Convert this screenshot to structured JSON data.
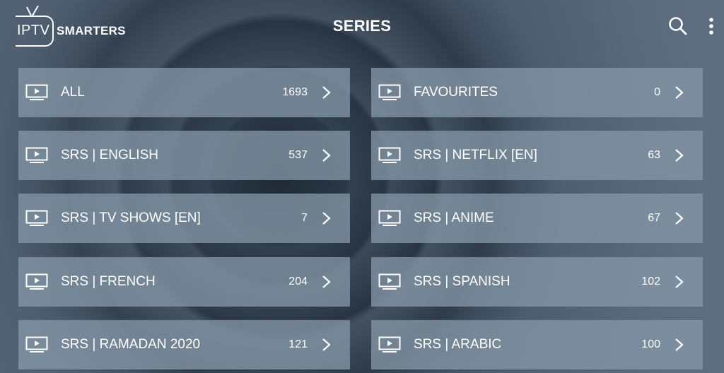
{
  "header": {
    "logo_iptv": "IPTV",
    "logo_smarters": "SMARTERS",
    "title": "SERIES",
    "search_icon": "search-icon",
    "more_icon": "more-vertical-icon"
  },
  "categories": [
    {
      "label": "ALL",
      "count": "1693"
    },
    {
      "label": "FAVOURITES",
      "count": "0"
    },
    {
      "label": "SRS | ENGLISH",
      "count": "537"
    },
    {
      "label": "SRS | NETFLIX [EN]",
      "count": "63"
    },
    {
      "label": "SRS | TV SHOWS [EN]",
      "count": "7"
    },
    {
      "label": "SRS | ANIME",
      "count": "67"
    },
    {
      "label": "SRS | FRENCH",
      "count": "204"
    },
    {
      "label": "SRS | SPANISH",
      "count": "102"
    },
    {
      "label": "SRS | RAMADAN 2020",
      "count": "121"
    },
    {
      "label": "SRS | ARABIC",
      "count": "100"
    }
  ],
  "icons": {
    "category": "tv-icon",
    "open": "chevron-right-icon"
  },
  "colors": {
    "tile_background": "#8496a6",
    "text": "#ffffff",
    "background": "#3a4858"
  }
}
